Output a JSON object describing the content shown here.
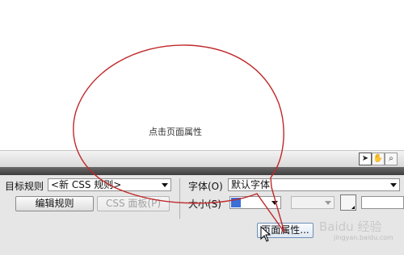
{
  "panel": {
    "target_rule_label": "目标规则",
    "target_rule_value": "<新 CSS 规则>",
    "edit_rule_button": "编辑规则",
    "css_panel_button": "CSS 面板(P)",
    "font_label": "字体(O)",
    "font_value": "默认字体",
    "size_label": "大小(S)",
    "page_properties_button": "页面属性..."
  },
  "annotation": {
    "text": "点击页面属性",
    "color": "#c0282a"
  },
  "statusbar": {
    "tools": [
      "pointer-icon",
      "hand-icon",
      "zoom-icon"
    ]
  },
  "watermark": {
    "text": "Baidu 经验",
    "url": "jingyan.baidu.com"
  }
}
